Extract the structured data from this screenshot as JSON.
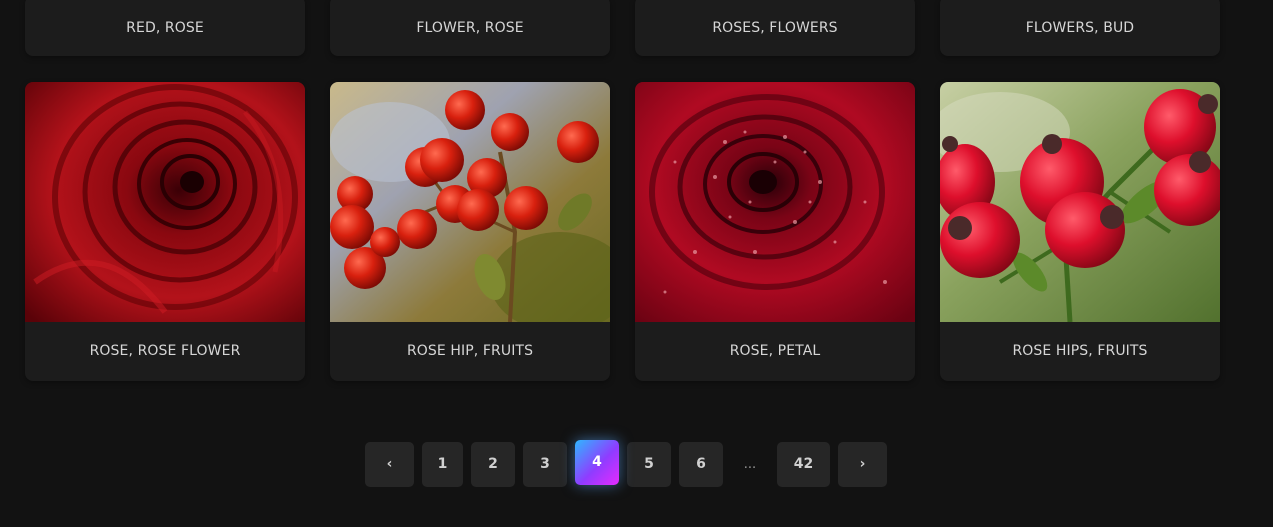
{
  "top_row": [
    {
      "caption": "RED, ROSE"
    },
    {
      "caption": "FLOWER, ROSE"
    },
    {
      "caption": "ROSES, FLOWERS"
    },
    {
      "caption": "FLOWERS, BUD"
    }
  ],
  "bottom_row": [
    {
      "caption": "ROSE, ROSE FLOWER",
      "image": "red-rose-closeup"
    },
    {
      "caption": "ROSE HIP, FRUITS",
      "image": "rose-hip-branch"
    },
    {
      "caption": "ROSE, PETAL",
      "image": "rose-with-dew-drops"
    },
    {
      "caption": "ROSE HIPS, FRUITS",
      "image": "rose-hips-closeup"
    }
  ],
  "pagination": {
    "prev_icon": "‹",
    "next_icon": "›",
    "pages": [
      "1",
      "2",
      "3",
      "4",
      "5",
      "6"
    ],
    "active": "4",
    "ellipsis": "...",
    "last": "42"
  },
  "colors": {
    "background": "#121212",
    "card": "#1c1c1c",
    "button": "#262626",
    "active_gradient_start": "#2fb7ff",
    "active_gradient_end": "#e52bff"
  }
}
